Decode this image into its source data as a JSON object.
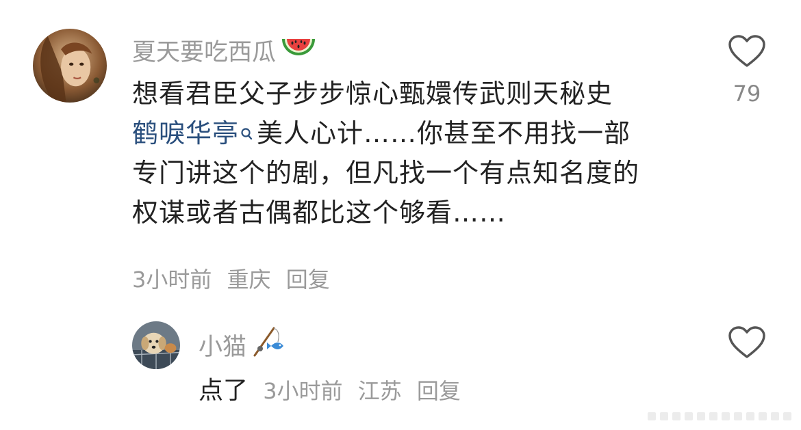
{
  "comment": {
    "username": "夏天要吃西瓜",
    "username_emoji": "watermelon-icon",
    "lines": {
      "line1": "想看君臣父子步步惊心甄嬛传武则天秘史",
      "line2_link": "鹤唳华亭",
      "line2_rest": "美人心计……你甚至不用找一部",
      "line3": "专门讲这个的剧，但凡找一个有点知名度的",
      "line4": "权谋或者古偶都比这个够看……"
    },
    "time": "3小时前",
    "location": "重庆",
    "reply_label": "回复",
    "like_count": "79"
  },
  "reply": {
    "username": "小猫",
    "username_badge": "fishing-rod-icon",
    "text": "点了",
    "time": "3小时前",
    "location": "江苏",
    "reply_label": "回复"
  },
  "colors": {
    "username": "#9a9a9a",
    "body": "#222222",
    "link": "#2a4f7d",
    "meta": "#9a9a9a"
  }
}
